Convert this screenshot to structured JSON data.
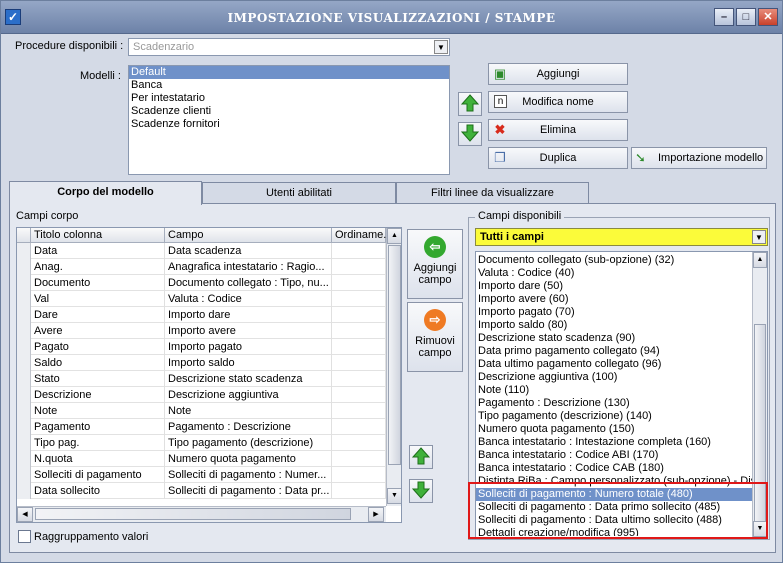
{
  "window": {
    "title": "IMPOSTAZIONE VISUALIZZAZIONI / STAMPE"
  },
  "procedure": {
    "label": "Procedure disponibili :",
    "value": "Scadenzario"
  },
  "modelli": {
    "label": "Modelli :",
    "items": [
      "Default",
      "Banca",
      "Per intestatario",
      "Scadenze clienti",
      "Scadenze fornitori"
    ],
    "selected_index": 0
  },
  "actions": {
    "aggiungi": "Aggiungi",
    "modifica_nome": "Modifica nome",
    "elimina": "Elimina",
    "duplica": "Duplica",
    "importazione_modello": "Importazione modello"
  },
  "tabs": [
    "Corpo del modello",
    "Utenti abilitati",
    "Filtri linee da visualizzare"
  ],
  "active_tab": 0,
  "campi_corpo": {
    "label": "Campi corpo",
    "columns": [
      "Titolo colonna",
      "Campo",
      "Ordiname..."
    ],
    "rows": [
      [
        "Data",
        "Data scadenza",
        ""
      ],
      [
        "Anag.",
        "Anagrafica intestatario : Ragio...",
        ""
      ],
      [
        "Documento",
        "Documento collegato : Tipo, nu...",
        ""
      ],
      [
        "Val",
        "Valuta : Codice",
        ""
      ],
      [
        "Dare",
        "Importo dare",
        ""
      ],
      [
        "Avere",
        "Importo avere",
        ""
      ],
      [
        "Pagato",
        "Importo pagato",
        ""
      ],
      [
        "Saldo",
        "Importo saldo",
        ""
      ],
      [
        "Stato",
        "Descrizione stato scadenza",
        ""
      ],
      [
        "Descrizione",
        "Descrizione aggiuntiva",
        ""
      ],
      [
        "Note",
        "Note",
        ""
      ],
      [
        "Pagamento",
        "Pagamento : Descrizione",
        ""
      ],
      [
        "Tipo pag.",
        "Tipo pagamento (descrizione)",
        ""
      ],
      [
        "N.quota",
        "Numero quota pagamento",
        ""
      ],
      [
        "Solleciti di pagamento",
        "Solleciti di pagamento : Numer...",
        ""
      ],
      [
        "Data sollecito",
        "Solleciti di pagamento : Data pr...",
        ""
      ]
    ]
  },
  "side_buttons": {
    "aggiungi_campo": [
      "Aggiungi",
      "campo"
    ],
    "rimuovi_campo": [
      "Rimuovi",
      "campo"
    ]
  },
  "campi_disponibili": {
    "label": "Campi disponibili",
    "filter": "Tutti i campi",
    "items": [
      "Documento collegato (sub-opzione) (32)",
      "Valuta : Codice (40)",
      "Importo dare (50)",
      "Importo avere (60)",
      "Importo pagato (70)",
      "Importo saldo (80)",
      "Descrizione stato scadenza (90)",
      "Data primo pagamento collegato (94)",
      "Data ultimo pagamento collegato (96)",
      "Descrizione aggiuntiva (100)",
      "Note (110)",
      "Pagamento : Descrizione (130)",
      "Tipo pagamento (descrizione) (140)",
      "Numero quota pagamento (150)",
      "Banca intestatario : Intestazione completa (160)",
      "Banca intestatario : Codice ABI (170)",
      "Banca intestatario : Codice CAB (180)",
      "Distinta RiBa : Campo personalizzato (sub-opzione) - Dist",
      "Solleciti di pagamento : Numero totale (480)",
      "Solleciti di pagamento : Data primo sollecito (485)",
      "Solleciti di pagamento : Data ultimo sollecito (488)",
      "Dettagli creazione/modifica (995)"
    ],
    "selected_index": 18
  },
  "raggruppamento": {
    "label": "Raggruppamento valori",
    "checked": false
  },
  "colors": {
    "selection": "#6f91c9",
    "filter_bg": "#fbfb3a",
    "highlight_border": "#e01818",
    "title_bar": "#7f93b8"
  }
}
